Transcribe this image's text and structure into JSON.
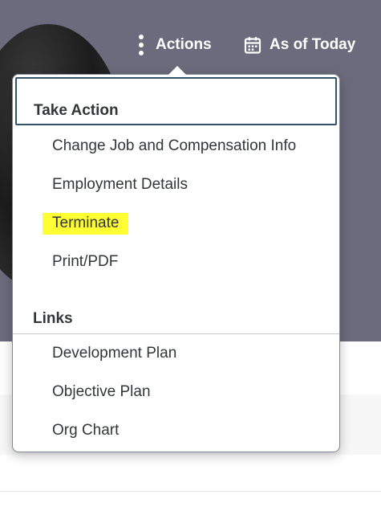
{
  "header": {
    "actions_label": "Actions",
    "as_of_label": "As of Today",
    "background_color": "#6b6b7d"
  },
  "menu": {
    "sections": [
      {
        "title": "Take Action",
        "items": [
          {
            "label": "Change Job and Compensation Info"
          },
          {
            "label": "Employment Details"
          },
          {
            "label": "Terminate",
            "highlighted": true,
            "highlight_color": "#ffff33"
          },
          {
            "label": "Print/PDF"
          }
        ]
      },
      {
        "title": "Links",
        "items": [
          {
            "label": "Development Plan"
          },
          {
            "label": "Objective Plan"
          },
          {
            "label": "Org Chart"
          }
        ]
      }
    ]
  },
  "icons": {
    "actions": "kebab-vertical-icon",
    "as_of": "calendar-icon"
  }
}
